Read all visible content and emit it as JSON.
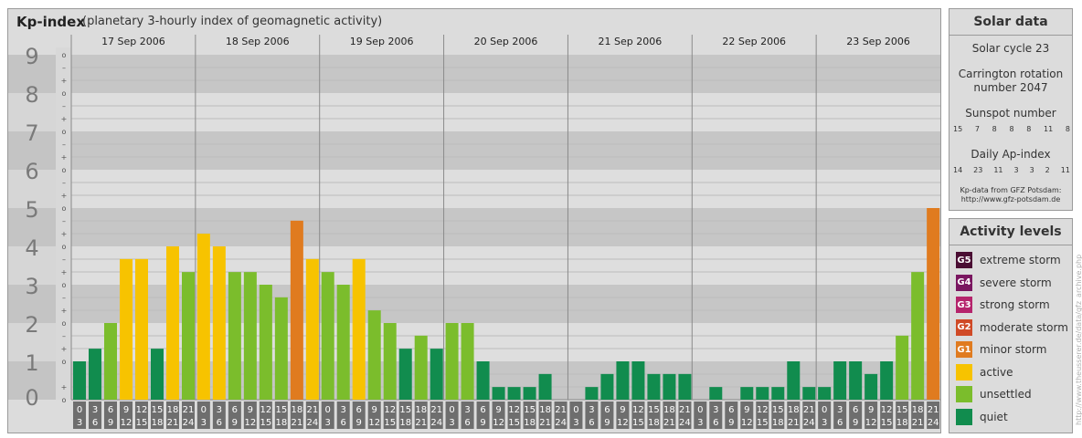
{
  "header": {
    "title": "Kp-index",
    "subtitle": "(planetary 3-hourly index of geomagnetic activity)"
  },
  "colors": {
    "quiet": "#118c4e",
    "unsettled": "#7bbd2c",
    "active": "#f7c300",
    "minor_storm": "#e07b1f",
    "moderate_storm": "#d04a26",
    "strong_storm": "#b5246c",
    "severe_storm": "#7a1660",
    "extreme_storm": "#4a0d33"
  },
  "chart_data": {
    "type": "bar",
    "title": "Kp-index",
    "subtitle": "(planetary 3-hourly index of geomagnetic activity)",
    "ylim": [
      0,
      9
    ],
    "y_ticks": [
      "0",
      "1",
      "2",
      "3",
      "4",
      "5",
      "6",
      "7",
      "8",
      "9"
    ],
    "y_subticks": [
      "o",
      "+",
      "-"
    ],
    "dates": [
      "17 Sep 2006",
      "18 Sep 2006",
      "19 Sep 2006",
      "20 Sep 2006",
      "21 Sep 2006",
      "22 Sep 2006",
      "23 Sep 2006"
    ],
    "hour_start": [
      "0",
      "3",
      "6",
      "9",
      "12",
      "15",
      "18",
      "21"
    ],
    "hour_end": [
      "3",
      "6",
      "9",
      "12",
      "15",
      "18",
      "21",
      "24"
    ],
    "values": [
      [
        1.0,
        1.33,
        2.0,
        3.67,
        3.67,
        1.33,
        4.0,
        3.33
      ],
      [
        4.33,
        4.0,
        3.33,
        3.33,
        3.0,
        2.67,
        4.67,
        3.67
      ],
      [
        3.33,
        3.0,
        3.67,
        2.33,
        2.0,
        1.33,
        1.67,
        1.33
      ],
      [
        2.0,
        2.0,
        1.0,
        0.33,
        0.33,
        0.33,
        0.67,
        0.0
      ],
      [
        0.0,
        0.33,
        0.67,
        1.0,
        1.0,
        0.67,
        0.67,
        0.67
      ],
      [
        0.0,
        0.33,
        0.0,
        0.33,
        0.33,
        0.33,
        1.0,
        0.33
      ],
      [
        0.33,
        1.0,
        1.0,
        0.67,
        1.0,
        1.67,
        3.33,
        5.0
      ]
    ],
    "grid": true
  },
  "solar": {
    "title": "Solar data",
    "cycle": "Solar cycle 23",
    "carrington_line1": "Carrington rotation",
    "carrington_line2": "number 2047",
    "sunspot_label": "Sunspot number",
    "sunspot_values": [
      "15",
      "7",
      "8",
      "8",
      "8",
      "11",
      "8"
    ],
    "ap_label": "Daily Ap-index",
    "ap_values": [
      "14",
      "23",
      "11",
      "3",
      "3",
      "2",
      "11"
    ],
    "source_line1": "Kp-data from GFZ Potsdam:",
    "source_line2": "http://www.gfz-potsdam.de"
  },
  "activity": {
    "title": "Activity levels",
    "levels": [
      {
        "badge": "G5",
        "label": "extreme storm",
        "color": "#4a0d33"
      },
      {
        "badge": "G4",
        "label": "severe storm",
        "color": "#7a1660"
      },
      {
        "badge": "G3",
        "label": "strong storm",
        "color": "#b5246c"
      },
      {
        "badge": "G2",
        "label": "moderate storm",
        "color": "#d04a26"
      },
      {
        "badge": "G1",
        "label": "minor storm",
        "color": "#e07b1f"
      },
      {
        "badge": "",
        "label": "active",
        "color": "#f7c300"
      },
      {
        "badge": "",
        "label": "unsettled",
        "color": "#7bbd2c"
      },
      {
        "badge": "",
        "label": "quiet",
        "color": "#118c4e"
      }
    ]
  },
  "watermark": "http://www.theusserer.de/data/gfz_archive.php"
}
